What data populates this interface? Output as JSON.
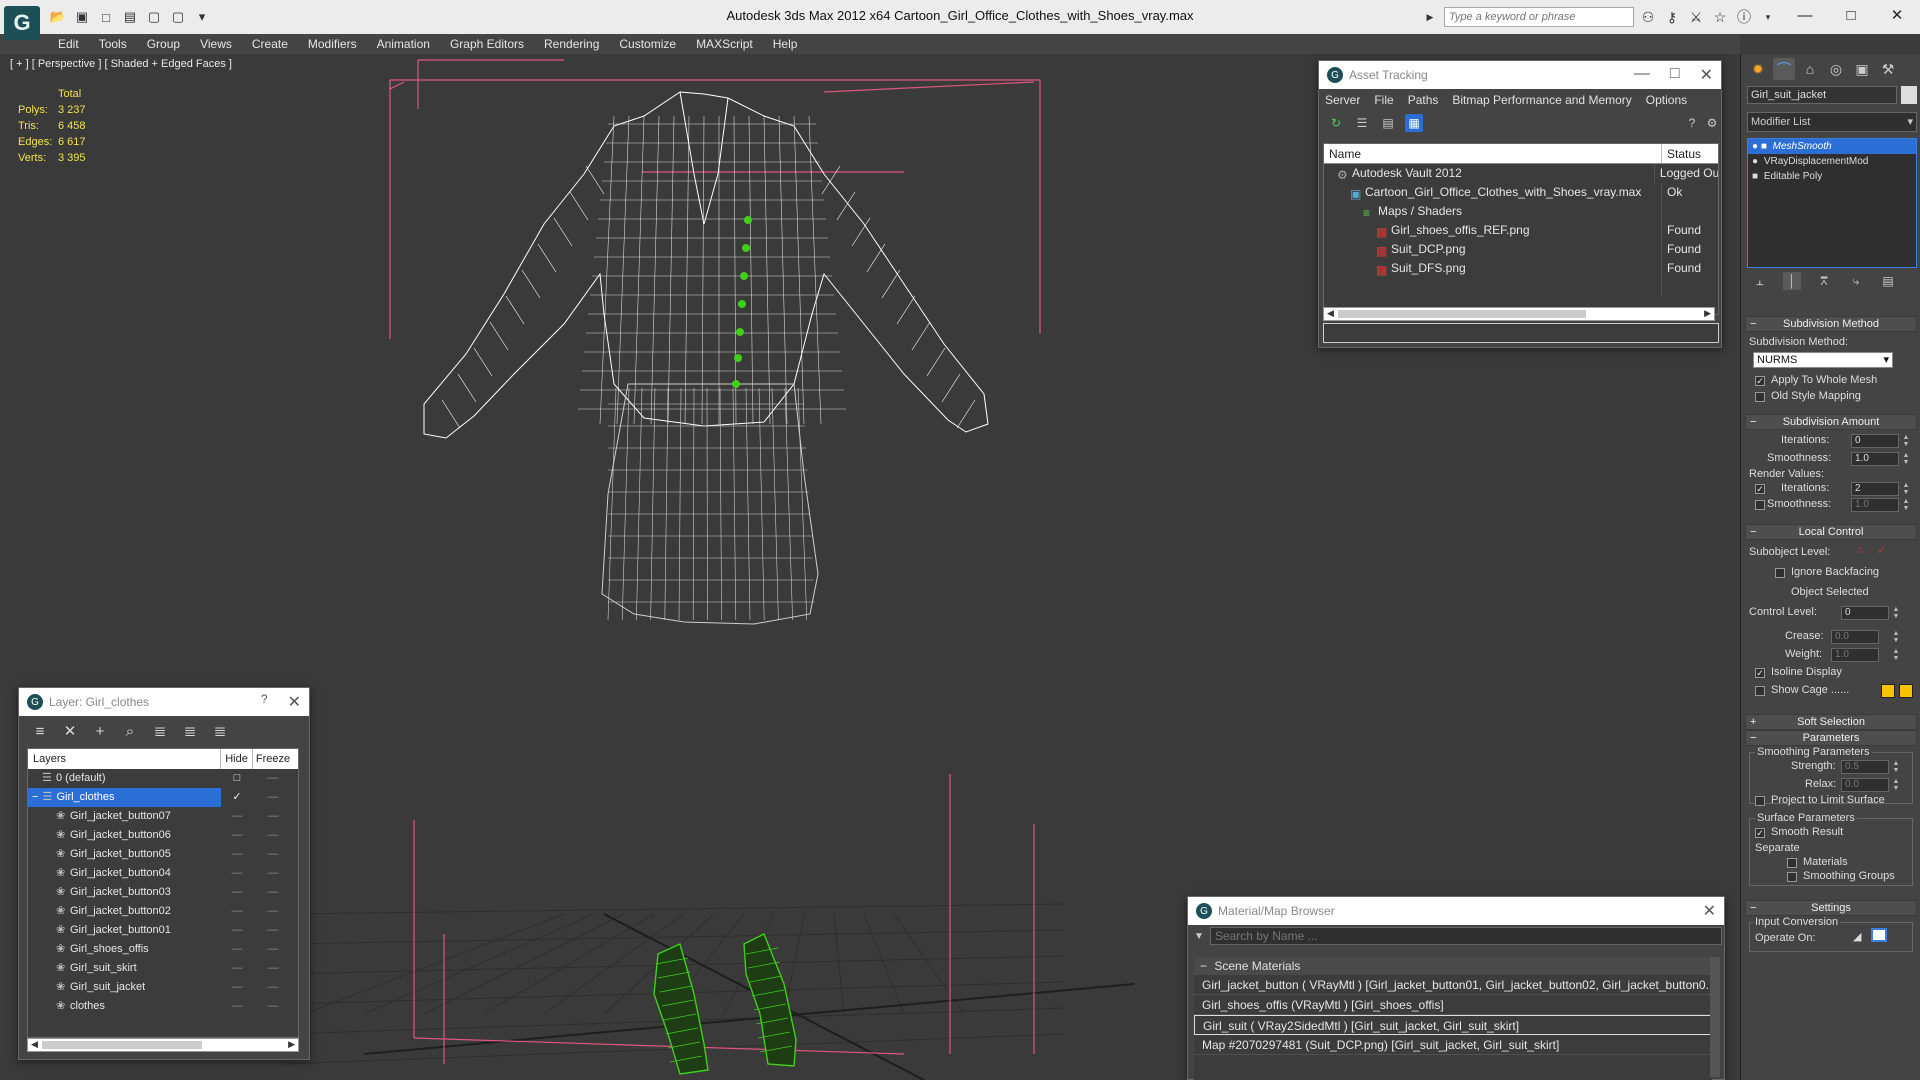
{
  "app": {
    "title": "Autodesk 3ds Max  2012 x64      Cartoon_Girl_Office_Clothes_with_Shoes_vray.max",
    "logo": "G",
    "search_placeholder": "Type a keyword or phrase"
  },
  "menu": [
    "Edit",
    "Tools",
    "Group",
    "Views",
    "Create",
    "Modifiers",
    "Animation",
    "Graph Editors",
    "Rendering",
    "Customize",
    "MAXScript",
    "Help"
  ],
  "viewport": {
    "label": "[ + ] [ Perspective ] [ Shaded + Edged Faces ]",
    "stats_header": "Total",
    "stats": [
      {
        "k": "Polys:",
        "v": "3 237"
      },
      {
        "k": "Tris:",
        "v": "6 458"
      },
      {
        "k": "Edges:",
        "v": "6 617"
      },
      {
        "k": "Verts:",
        "v": "3 395"
      }
    ]
  },
  "asset_tracking": {
    "title": "Asset Tracking",
    "menu": [
      "Server",
      "File",
      "Paths",
      "Bitmap Performance and Memory",
      "Options"
    ],
    "col_name": "Name",
    "col_status": "Status",
    "rows": [
      {
        "name": "Autodesk Vault 2012",
        "status": "Logged Ou",
        "indent": 1,
        "icon": "vault"
      },
      {
        "name": "Cartoon_Girl_Office_Clothes_with_Shoes_vray.max",
        "status": "Ok",
        "indent": 2,
        "icon": "max"
      },
      {
        "name": "Maps / Shaders",
        "status": "",
        "indent": 3,
        "icon": "maps"
      },
      {
        "name": "Girl_shoes_offis_REF.png",
        "status": "Found",
        "indent": 4,
        "icon": "png"
      },
      {
        "name": "Suit_DCP.png",
        "status": "Found",
        "indent": 4,
        "icon": "png"
      },
      {
        "name": "Suit_DFS.png",
        "status": "Found",
        "indent": 4,
        "icon": "png"
      }
    ]
  },
  "layer_panel": {
    "title": "Layer: Girl_clothes",
    "col_layers": "Layers",
    "col_hide": "Hide",
    "col_freeze": "Freeze",
    "rows": [
      {
        "name": "0 (default)",
        "indent": 1,
        "sel": false,
        "mark": "□"
      },
      {
        "name": "Girl_clothes",
        "indent": 0,
        "sel": true,
        "mark": "✓"
      },
      {
        "name": "Girl_jacket_button07",
        "indent": 2,
        "sel": false,
        "mark": ""
      },
      {
        "name": "Girl_jacket_button06",
        "indent": 2,
        "sel": false,
        "mark": ""
      },
      {
        "name": "Girl_jacket_button05",
        "indent": 2,
        "sel": false,
        "mark": ""
      },
      {
        "name": "Girl_jacket_button04",
        "indent": 2,
        "sel": false,
        "mark": ""
      },
      {
        "name": "Girl_jacket_button03",
        "indent": 2,
        "sel": false,
        "mark": ""
      },
      {
        "name": "Girl_jacket_button02",
        "indent": 2,
        "sel": false,
        "mark": ""
      },
      {
        "name": "Girl_jacket_button01",
        "indent": 2,
        "sel": false,
        "mark": ""
      },
      {
        "name": "Girl_shoes_offis",
        "indent": 2,
        "sel": false,
        "mark": ""
      },
      {
        "name": "Girl_suit_skirt",
        "indent": 2,
        "sel": false,
        "mark": ""
      },
      {
        "name": "Girl_suit_jacket",
        "indent": 2,
        "sel": false,
        "mark": ""
      },
      {
        "name": "clothes",
        "indent": 2,
        "sel": false,
        "mark": ""
      }
    ]
  },
  "material_browser": {
    "title": "Material/Map Browser",
    "search_placeholder": "Search by Name ...",
    "group": "Scene Materials",
    "rows": [
      {
        "text": "Girl_jacket_button  ( VRayMtl ) [Girl_jacket_button01, Girl_jacket_button02, Girl_jacket_button0...",
        "sel": false
      },
      {
        "text": "Girl_shoes_offis  (VRayMtl ) [Girl_shoes_offis]",
        "sel": false
      },
      {
        "text": "Girl_suit  ( VRay2SidedMtl ) [Girl_suit_jacket, Girl_suit_skirt]",
        "sel": true
      },
      {
        "text": "Map #2070297481 (Suit_DCP.png)  [Girl_suit_jacket, Girl_suit_skirt]",
        "sel": false
      }
    ]
  },
  "command_panel": {
    "object_name": "Girl_suit_jacket",
    "modifier_list": "Modifier List",
    "stack": [
      {
        "name": "MeshSmooth",
        "sel": true
      },
      {
        "name": "VRayDisplacementMod",
        "sel": false
      },
      {
        "name": "Editable Poly",
        "sel": false
      }
    ],
    "subdivision_method": {
      "header": "Subdivision Method",
      "label": "Subdivision Method:",
      "value": "NURMS",
      "apply_whole_mesh": "Apply To Whole Mesh",
      "old_style_mapping": "Old Style Mapping"
    },
    "subdivision_amount": {
      "header": "Subdivision Amount",
      "iterations_label": "Iterations:",
      "iterations": "0",
      "smoothness_label": "Smoothness:",
      "smoothness": "1.0",
      "render_values": "Render Values:",
      "r_iterations_label": "Iterations:",
      "r_iterations": "2",
      "r_smoothness_label": "Smoothness:",
      "r_smoothness": "1.0"
    },
    "local_control": {
      "header": "Local Control",
      "subobject_level": "Subobject Level:",
      "ignore_backfacing": "Ignore Backfacing",
      "object_selected": "Object Selected",
      "control_level_label": "Control Level:",
      "control_level": "0",
      "crease_label": "Crease:",
      "crease": "0.0",
      "weight_label": "Weight:",
      "weight": "1.0",
      "isoline_display": "Isoline Display",
      "show_cage": "Show Cage ......"
    },
    "soft_selection": "Soft Selection",
    "parameters": {
      "header": "Parameters",
      "smoothing_params": "Smoothing Parameters",
      "strength_label": "Strength:",
      "strength": "0.5",
      "relax_label": "Relax:",
      "relax": "0.0",
      "project_limit": "Project to Limit Surface",
      "surface_params": "Surface Parameters",
      "smooth_result": "Smooth Result",
      "separate": "Separate",
      "materials": "Materials",
      "smoothing_groups": "Smoothing Groups"
    },
    "settings": {
      "header": "Settings",
      "input_conversion": "Input Conversion",
      "operate_on": "Operate On:"
    }
  },
  "colors": {
    "accent": "#2b6fd6",
    "wire": "#ffffff",
    "shoes": "#3fd01a",
    "bbox": "#e0557f",
    "stats": "#f2e24a",
    "cage": "#f7c300"
  }
}
